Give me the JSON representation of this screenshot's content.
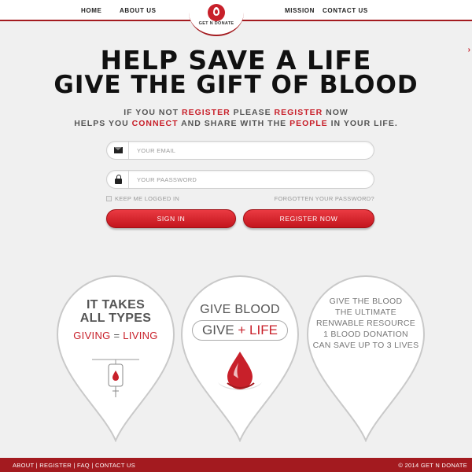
{
  "nav": {
    "home": "HOME",
    "about": "ABOUT US",
    "mission": "MISSION",
    "contact": "CONTACT US"
  },
  "logo": {
    "text": "GET N DONATE"
  },
  "hero": {
    "line1": "HELP SAVE A LIFE",
    "line2": "GIVE THE GIFT OF BLOOD"
  },
  "tagline": {
    "line1": [
      {
        "text": "IF YOU  NOT ",
        "red": false
      },
      {
        "text": "REGISTER",
        "red": true
      },
      {
        "text": " PLEASE ",
        "red": false
      },
      {
        "text": "REGISTER",
        "red": true
      },
      {
        "text": " NOW",
        "red": false
      }
    ],
    "line2": [
      {
        "text": "HELPS YOU ",
        "red": false
      },
      {
        "text": "CONNECT",
        "red": true
      },
      {
        "text": " AND SHARE WITH THE ",
        "red": false
      },
      {
        "text": "PEOPLE",
        "red": true
      },
      {
        "text": " IN YOUR LIFE.",
        "red": false
      }
    ]
  },
  "form": {
    "email_placeholder": "YOUR EMAIL",
    "password_placeholder": "YOUR PAASSWORD",
    "remember_label": "KEEP ME LOGGED IN",
    "forgot_label": "FORGOTTEN YOUR PASSWORD?",
    "signin_label": "SIGN IN",
    "register_label": "REGISTER NOW"
  },
  "pins": {
    "types": {
      "line1": "IT TAKES",
      "line2": "ALL TYPES",
      "giving": "GIVING",
      "equals": " = ",
      "living": "LIVING"
    },
    "give": {
      "title": "GIVE BLOOD",
      "give_word": "GIVE",
      "plus_life": "+ LIFE"
    },
    "facts": {
      "lines": [
        "GIVE THE BLOOD",
        "THE ULTIMATE",
        "RENWABLE RESOURCE",
        "1 BLOOD DONATION",
        "CAN SAVE UP TO 3 LIVES"
      ]
    }
  },
  "footer": {
    "about": "ABOUT",
    "register": "REGISTER",
    "faq": "FAQ",
    "contact": "CONTACT US",
    "separator": "|",
    "copyright": "© 2014 GET N DONATE"
  },
  "colors": {
    "brand_red": "#c8202a",
    "dark_red": "#a31a1f",
    "background": "#f0f0f0"
  },
  "icons": [
    "envelope-icon",
    "lock-icon",
    "logo-drop-icon",
    "blood-drop-icon",
    "iv-bag-icon",
    "chevron-right-icon"
  ]
}
